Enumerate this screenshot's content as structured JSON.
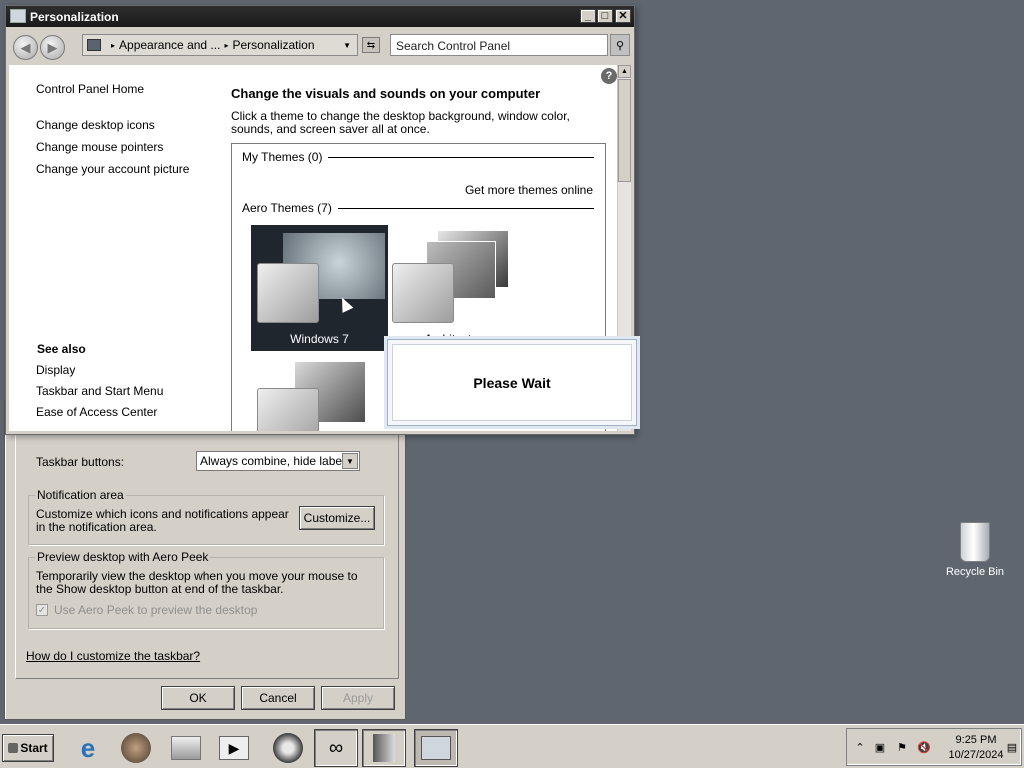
{
  "personalization": {
    "title": "Personalization",
    "breadcrumb": [
      "Appearance and ...",
      "Personalization"
    ],
    "search_placeholder": "Search Control Panel",
    "left_nav": {
      "home": "Control Panel Home",
      "links": [
        "Change desktop icons",
        "Change mouse pointers",
        "Change your account picture"
      ],
      "see_also_title": "See also",
      "see_also": [
        "Display",
        "Taskbar and Start Menu",
        "Ease of Access Center"
      ]
    },
    "heading": "Change the visuals and sounds on your computer",
    "description": "Click a theme to change the desktop background, window color, sounds, and screen saver all at once.",
    "my_themes": "My Themes (0)",
    "get_more": "Get more themes online",
    "aero_themes": "Aero Themes (7)",
    "themes": [
      {
        "name": "Windows 7",
        "selected": true
      },
      {
        "name": "Architecture",
        "selected": false
      }
    ],
    "please_wait": "Please Wait"
  },
  "taskbar_props": {
    "taskbar_buttons_label": "Taskbar buttons:",
    "taskbar_buttons_value": "Always combine, hide labels",
    "notification": {
      "title": "Notification area",
      "text": "Customize which icons and notifications appear in the notification area.",
      "button": "Customize..."
    },
    "peek": {
      "title": "Preview desktop with Aero Peek",
      "text": "Temporarily view the desktop when you move your mouse to the Show desktop button at end of the taskbar.",
      "checkbox": "Use Aero Peek to preview the desktop",
      "checked": true
    },
    "help_link": "How do I customize the taskbar?",
    "ok": "OK",
    "cancel": "Cancel",
    "apply": "Apply"
  },
  "desktop": {
    "recycle_bin": "Recycle Bin"
  },
  "taskbar": {
    "start": "Start",
    "apps": [
      "internet-explorer-icon",
      "media-center-icon",
      "printer-icon",
      "media-player-icon",
      "disc-burner-icon",
      "network-icon",
      "server-manager-icon",
      "control-panel-icon"
    ],
    "time": "9:25 PM",
    "date": "10/27/2024"
  },
  "colors": {
    "desktop": "#5f6670",
    "window_chrome": "#d4d0c8",
    "title_bar": "#1f1f1f"
  }
}
